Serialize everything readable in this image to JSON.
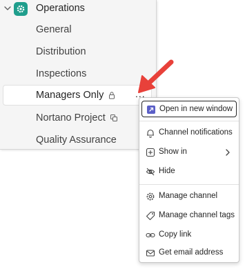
{
  "sidebar": {
    "team": {
      "name": "Operations",
      "icon": "gear-icon",
      "expanded_icon": "chevron-down-icon",
      "accent": "#1f9e8c"
    },
    "channels": [
      {
        "label": "General"
      },
      {
        "label": "Distribution"
      },
      {
        "label": "Inspections"
      },
      {
        "label": "Managers Only",
        "badge_icon": "lock-icon",
        "selected": true
      },
      {
        "label": "Nortano Project",
        "badge_icon": "shared-channel-icon"
      },
      {
        "label": "Quality Assurance"
      }
    ],
    "more_options_label": "..."
  },
  "context_menu": {
    "items": [
      {
        "label": "Open in new window",
        "icon": "open-window-icon",
        "focused": true
      },
      {
        "label": "Channel notifications",
        "icon": "bell-icon"
      },
      {
        "label": "Show in",
        "icon": "add-square-icon",
        "has_submenu": true
      },
      {
        "label": "Hide",
        "icon": "eye-off-icon"
      },
      {
        "label": "Manage channel",
        "icon": "gear-icon"
      },
      {
        "label": "Manage channel tags",
        "icon": "tag-icon"
      },
      {
        "label": "Copy link",
        "icon": "link-icon"
      },
      {
        "label": "Get email address",
        "icon": "mail-icon"
      }
    ]
  },
  "annotation": {
    "arrow_color": "#e8413a"
  }
}
